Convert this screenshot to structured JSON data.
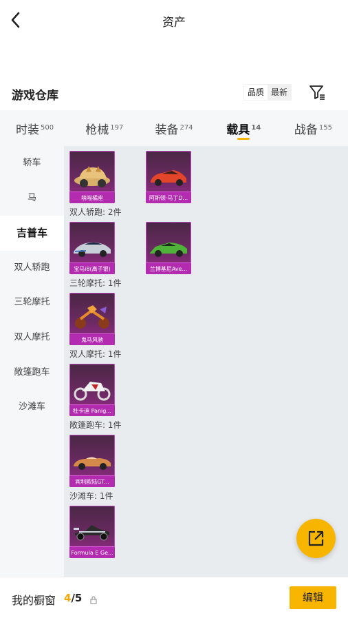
{
  "header": {
    "title": "资产"
  },
  "section": {
    "title": "游戏仓库",
    "sort": [
      "品质",
      "最新"
    ],
    "sort_active": 0
  },
  "categories": [
    {
      "label": "时装",
      "count": "500"
    },
    {
      "label": "枪械",
      "count": "197"
    },
    {
      "label": "装备",
      "count": "274"
    },
    {
      "label": "载具",
      "count": "14",
      "active": true
    },
    {
      "label": "战备",
      "count": "155"
    }
  ],
  "sidebar": [
    "轿车",
    "马",
    "吉普车",
    "双人轿跑",
    "三轮摩托",
    "双人摩托",
    "敞篷跑车",
    "沙滩车"
  ],
  "sidebar_active": 2,
  "groups": [
    {
      "label": "",
      "items": [
        {
          "name": "萌喵橘座",
          "icon": "beetle-car"
        },
        {
          "name": "阿斯顿·马丁D...",
          "icon": "red-sports-car"
        }
      ]
    },
    {
      "label": "双人轿跑: 2件",
      "items": [
        {
          "name": "宝马i8(离子银)",
          "icon": "silver-coupe"
        },
        {
          "name": "兰博基尼Ave...",
          "icon": "green-supercar"
        }
      ]
    },
    {
      "label": "三轮摩托: 1件",
      "items": [
        {
          "name": "鬼马风驰",
          "icon": "trike"
        }
      ]
    },
    {
      "label": "双人摩托: 1件",
      "items": [
        {
          "name": "杜卡迪 Panig...",
          "icon": "motorcycle"
        }
      ]
    },
    {
      "label": "敞篷跑车: 1件",
      "items": [
        {
          "name": "宾利欧陆GT...",
          "icon": "convertible"
        }
      ]
    },
    {
      "label": "沙滩车: 1件",
      "items": [
        {
          "name": "Formula E Ge...",
          "icon": "formula-car"
        }
      ]
    }
  ],
  "bottom": {
    "label": "我的橱窗",
    "count_current": "4",
    "count_total": "/5",
    "edit": "编辑"
  },
  "colors": {
    "accent": "#f7b500",
    "rarity": "#b32cb0"
  }
}
